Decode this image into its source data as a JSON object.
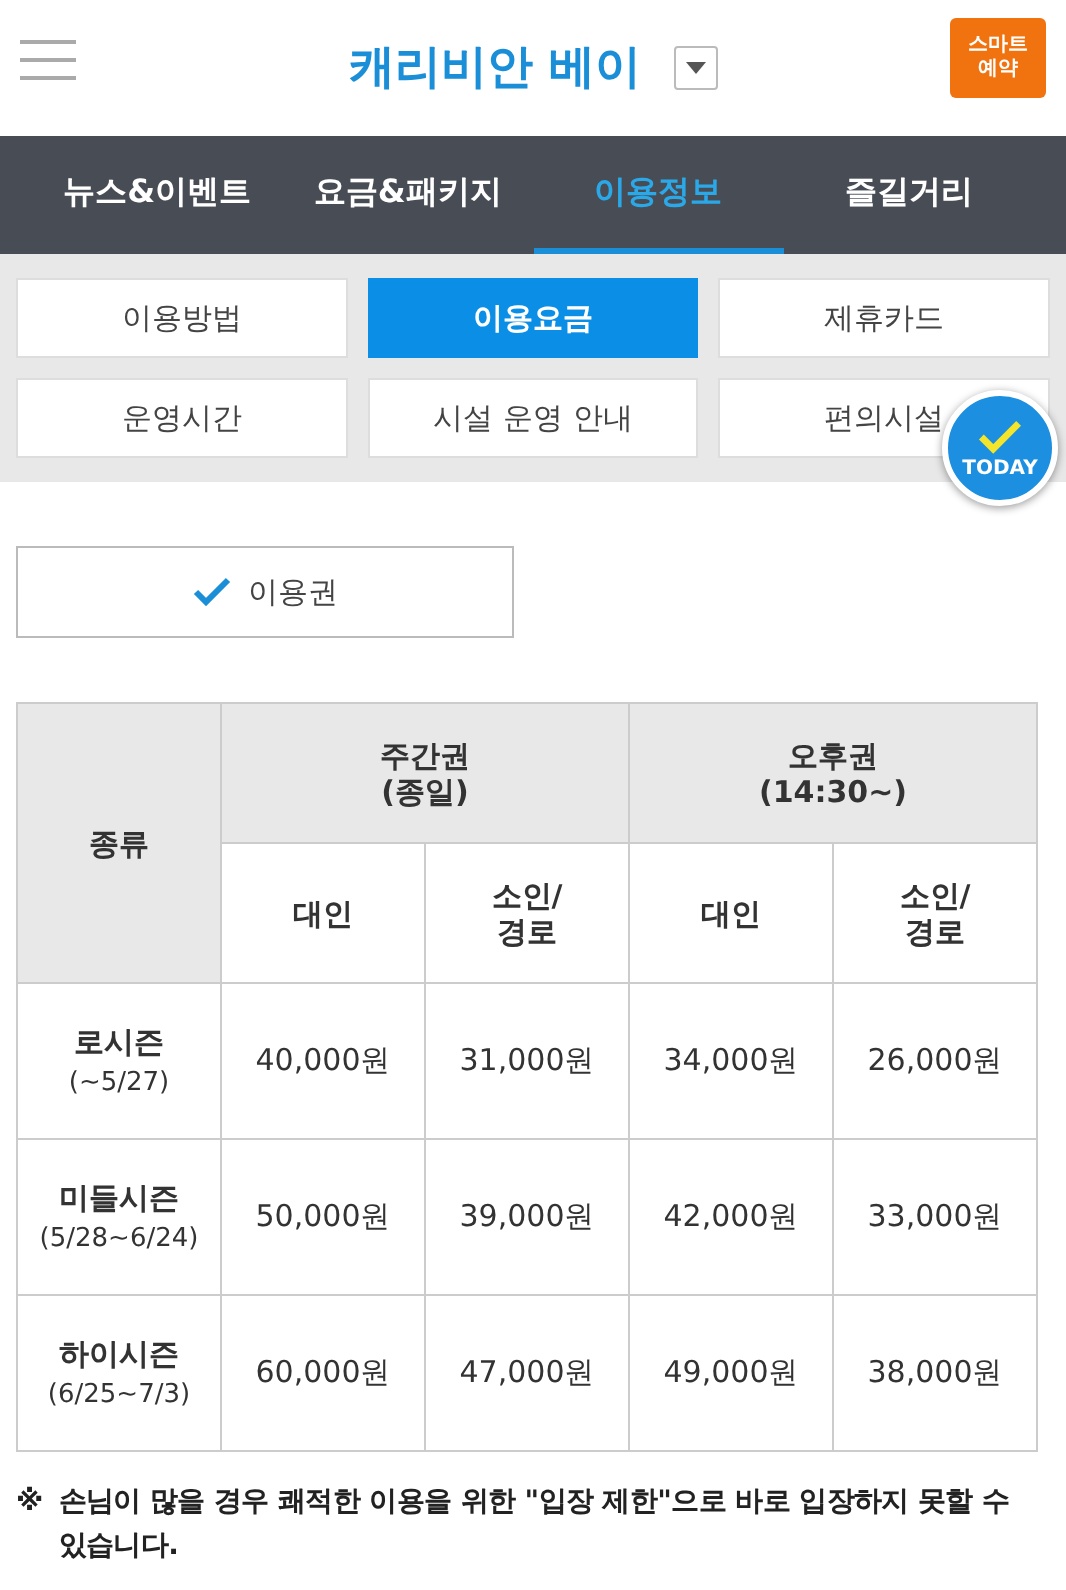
{
  "header": {
    "title": "캐리비안 베이",
    "reserve_button": "스마트\n예약"
  },
  "main_tabs": [
    {
      "label": "뉴스&이벤트",
      "selected": false
    },
    {
      "label": "요금&패키지",
      "selected": false
    },
    {
      "label": "이용정보",
      "selected": true
    },
    {
      "label": "즐길거리",
      "selected": false
    }
  ],
  "sub_tabs": [
    {
      "label": "이용방법",
      "selected": false
    },
    {
      "label": "이용요금",
      "selected": true
    },
    {
      "label": "제휴카드",
      "selected": false
    },
    {
      "label": "운영시간",
      "selected": false
    },
    {
      "label": "시설 운영 안내",
      "selected": false
    },
    {
      "label": "편의시설",
      "selected": false
    }
  ],
  "today_badge": "TODAY",
  "ticket_toggle": {
    "label": "이용권",
    "checked": true
  },
  "table": {
    "corner": "종류",
    "groups": [
      "주간권\n(종일)",
      "오후권\n(14:30~)"
    ],
    "columns": [
      "대인",
      "소인/\n경로",
      "대인",
      "소인/\n경로"
    ],
    "rows": [
      {
        "season": "로시즌",
        "dates": "(~5/27)",
        "values": [
          "40,000원",
          "31,000원",
          "34,000원",
          "26,000원"
        ]
      },
      {
        "season": "미들시즌",
        "dates": "(5/28~6/24)",
        "values": [
          "50,000원",
          "39,000원",
          "42,000원",
          "33,000원"
        ]
      },
      {
        "season": "하이시즌",
        "dates": "(6/25~7/3)",
        "values": [
          "60,000원",
          "47,000원",
          "49,000원",
          "38,000원"
        ]
      }
    ]
  },
  "note": {
    "mark": "※",
    "text": "손님이 많을 경우 쾌적한 이용을 위한 \"입장 제한\"으로 바로 입장하지 못할 수 있습니다."
  }
}
